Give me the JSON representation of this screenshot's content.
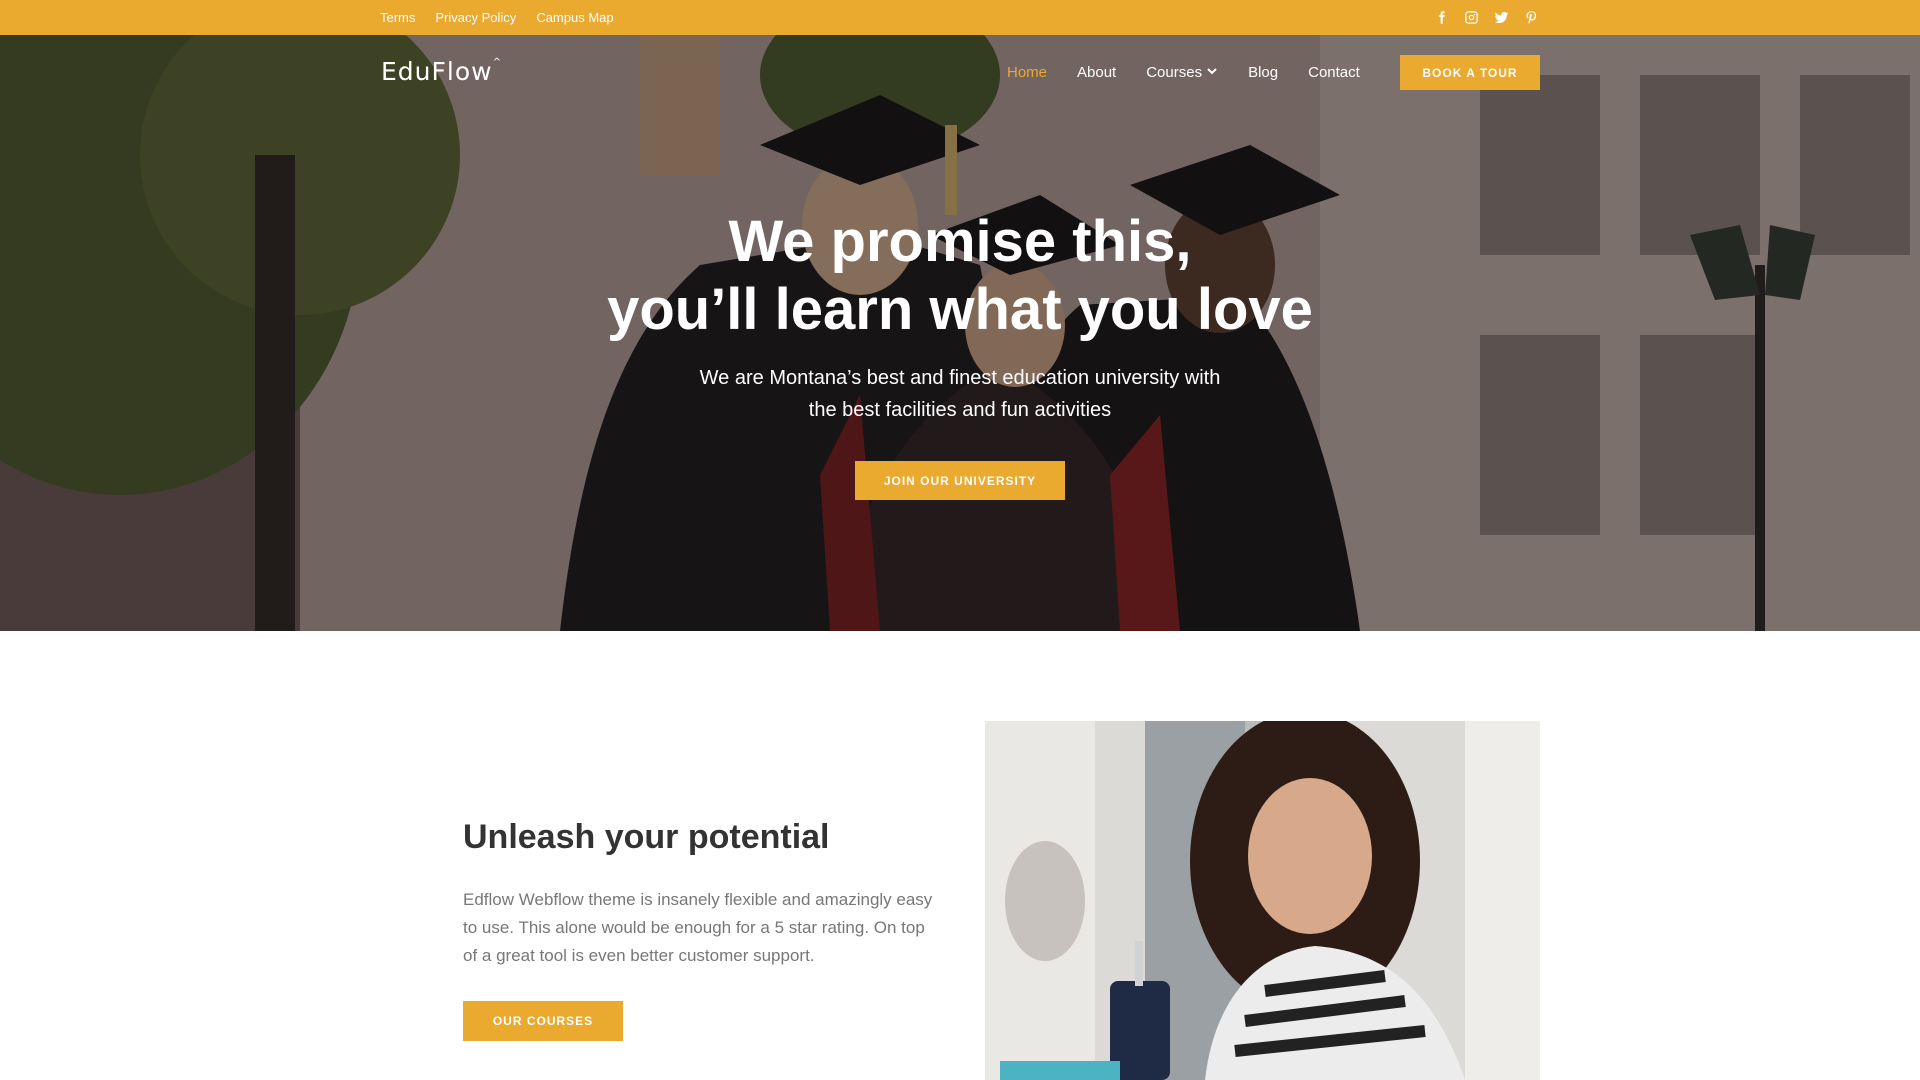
{
  "topbar": {
    "links": [
      "Terms",
      "Privacy Policy",
      "Campus Map"
    ],
    "social_icons": [
      "facebook-icon",
      "instagram-icon",
      "twitter-icon",
      "pinterest-icon"
    ]
  },
  "header": {
    "logo": "EduFlow",
    "logo_mark": "^",
    "nav": [
      {
        "label": "Home",
        "active": true
      },
      {
        "label": "About"
      },
      {
        "label": "Courses",
        "dropdown": true
      },
      {
        "label": "Blog"
      },
      {
        "label": "Contact"
      }
    ],
    "cta_label": "BOOK A TOUR"
  },
  "hero": {
    "title_line1": "We promise this,",
    "title_line2": "you’ll learn what you love",
    "subtitle_line1": "We are Montana’s best and finest education university with",
    "subtitle_line2": "the best facilities and fun activities",
    "button_label": "JOIN OUR UNIVERSITY"
  },
  "intro": {
    "title": "Unleash your potential",
    "text": "Edflow Webflow theme is insanely flexible and amazingly easy to use. This alone would be enough for a 5 star rating. On top of a great tool is even better customer support.",
    "button_label": "OUR COURSES"
  },
  "colors": {
    "accent": "#eaa92f",
    "text_dark": "#333333",
    "text_muted": "#777777"
  }
}
